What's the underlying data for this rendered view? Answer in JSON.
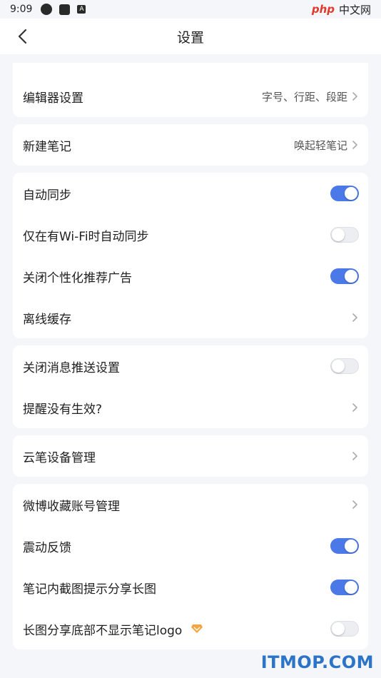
{
  "status_bar": {
    "time": "9:09",
    "watermark_php": "php",
    "watermark_cn": "中文网"
  },
  "header": {
    "title": "设置"
  },
  "sections": {
    "editor": {
      "label": "编辑器设置",
      "value": "字号、行距、段距"
    },
    "new_note": {
      "label": "新建笔记",
      "value": "唤起轻笔记"
    },
    "sync": {
      "auto_sync": {
        "label": "自动同步",
        "on": true
      },
      "wifi_sync": {
        "label": "仅在有Wi-Fi时自动同步",
        "on": false
      },
      "ads": {
        "label": "关闭个性化推荐广告",
        "on": true
      },
      "offline": {
        "label": "离线缓存"
      }
    },
    "notify": {
      "push": {
        "label": "关闭消息推送设置",
        "on": false
      },
      "reminder": {
        "label": "提醒没有生效?"
      }
    },
    "device": {
      "label": "云笔设备管理"
    },
    "misc": {
      "weibo": {
        "label": "微博收藏账号管理"
      },
      "vibration": {
        "label": "震动反馈",
        "on": true
      },
      "screenshot": {
        "label": "笔记内截图提示分享长图",
        "on": true
      },
      "logo": {
        "label": "长图分享底部不显示笔记logo",
        "on": false
      }
    }
  },
  "watermark_bottom": "ITMOP.COM",
  "colors": {
    "toggle_on": "#4b79e8",
    "vip": "#f2a540"
  }
}
